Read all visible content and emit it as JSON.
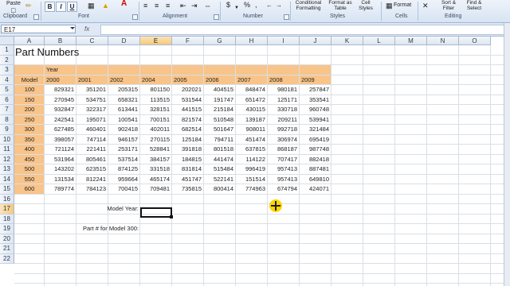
{
  "ribbon": {
    "paste": "Paste",
    "clipboard": "Clipboard",
    "font": "Font",
    "bold": "B",
    "italic": "I",
    "underline": "U",
    "alignment": "Alignment",
    "currency": "$",
    "percent": "%",
    "number": "Number",
    "conditional_formatting": "Conditional Formatting",
    "format_as_table": "Format as Table",
    "cell_styles": "Cell Styles",
    "styles": "Styles",
    "format": "Format",
    "cells": "Cells",
    "sort_filter": "Sort & Filter",
    "find_select": "Find & Select",
    "editing": "Editing"
  },
  "formula_bar": {
    "name_box": "E17",
    "fx": "fx",
    "content": ""
  },
  "columns": [
    "A",
    "B",
    "C",
    "D",
    "E",
    "F",
    "G",
    "H",
    "I",
    "J",
    "K",
    "L",
    "M",
    "N",
    "O"
  ],
  "selected_column": "E",
  "rows": [
    "1",
    "2",
    "3",
    "4",
    "5",
    "6",
    "7",
    "8",
    "9",
    "10",
    "11",
    "12",
    "13",
    "14",
    "15",
    "16",
    "17",
    "18",
    "19",
    "20",
    "21",
    "22"
  ],
  "selected_row": "17",
  "sheet": {
    "title": "Part Numbers",
    "year_label": "Year",
    "model_label": "Model",
    "years": [
      "2000",
      "2001",
      "2002",
      "2004",
      "2005",
      "2006",
      "2007",
      "2008",
      "2009"
    ],
    "models": [
      "100",
      "150",
      "200",
      "250",
      "300",
      "350",
      "400",
      "450",
      "500",
      "550",
      "600"
    ],
    "values": [
      [
        "829321",
        "351201",
        "205315",
        "801150",
        "202021",
        "404515",
        "848474",
        "980181",
        "257847"
      ],
      [
        "270945",
        "534751",
        "658321",
        "113515",
        "531544",
        "191747",
        "651472",
        "125171",
        "353541"
      ],
      [
        "932847",
        "322317",
        "613441",
        "328151",
        "441515",
        "215184",
        "430115",
        "330718",
        "960748"
      ],
      [
        "242541",
        "195071",
        "100541",
        "700151",
        "821574",
        "510548",
        "139187",
        "209211",
        "539941"
      ],
      [
        "627485",
        "460401",
        "902418",
        "402011",
        "682514",
        "501647",
        "908011",
        "992718",
        "321484"
      ],
      [
        "398057",
        "747114",
        "946157",
        "270115",
        "125184",
        "794711",
        "451474",
        "306974",
        "695419"
      ],
      [
        "721124",
        "221411",
        "253171",
        "528841",
        "391818",
        "801518",
        "637815",
        "868187",
        "987748"
      ],
      [
        "531964",
        "805461",
        "537514",
        "384157",
        "184815",
        "441474",
        "114122",
        "707417",
        "882418"
      ],
      [
        "143202",
        "623515",
        "874125",
        "331518",
        "831814",
        "515484",
        "996419",
        "957413",
        "887481"
      ],
      [
        "131534",
        "812241",
        "959664",
        "465174",
        "451747",
        "522141",
        "151514",
        "957413",
        "649810"
      ],
      [
        "789774",
        "784123",
        "700415",
        "709481",
        "735815",
        "800414",
        "774963",
        "674794",
        "424071"
      ]
    ],
    "model_year_label": "Model Year:",
    "part_for_model_label": "Part # for Model 300:"
  }
}
